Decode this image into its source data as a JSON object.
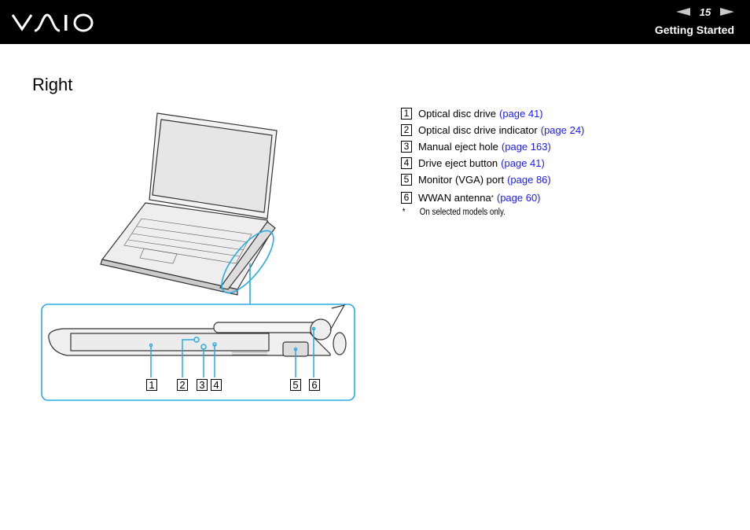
{
  "header": {
    "logo": "VAIO",
    "page_number": "15",
    "section": "Getting Started",
    "icons": {
      "prev": "left-triangle-arrow",
      "next": "right-triangle-arrow"
    }
  },
  "page": {
    "title": "Right",
    "items": [
      {
        "num": "1",
        "label": "Optical disc drive",
        "link": "(page 41)"
      },
      {
        "num": "2",
        "label": "Optical disc drive indicator",
        "link": "(page 24)"
      },
      {
        "num": "3",
        "label": "Manual eject hole",
        "link": "(page 163)"
      },
      {
        "num": "4",
        "label": "Drive eject button",
        "link": "(page 41)"
      },
      {
        "num": "5",
        "label": "Monitor (VGA) port",
        "link": "(page 86)"
      },
      {
        "num": "6",
        "label": "WWAN antenna",
        "sup": "*",
        "link": "(page 60)"
      }
    ],
    "footnote": {
      "mark": "*",
      "text": "On selected models only."
    },
    "illustration": {
      "callouts": [
        "1",
        "2",
        "3",
        "4",
        "5",
        "6"
      ],
      "accent_color": "#29abe2",
      "link_color": "#1a1aff"
    }
  }
}
